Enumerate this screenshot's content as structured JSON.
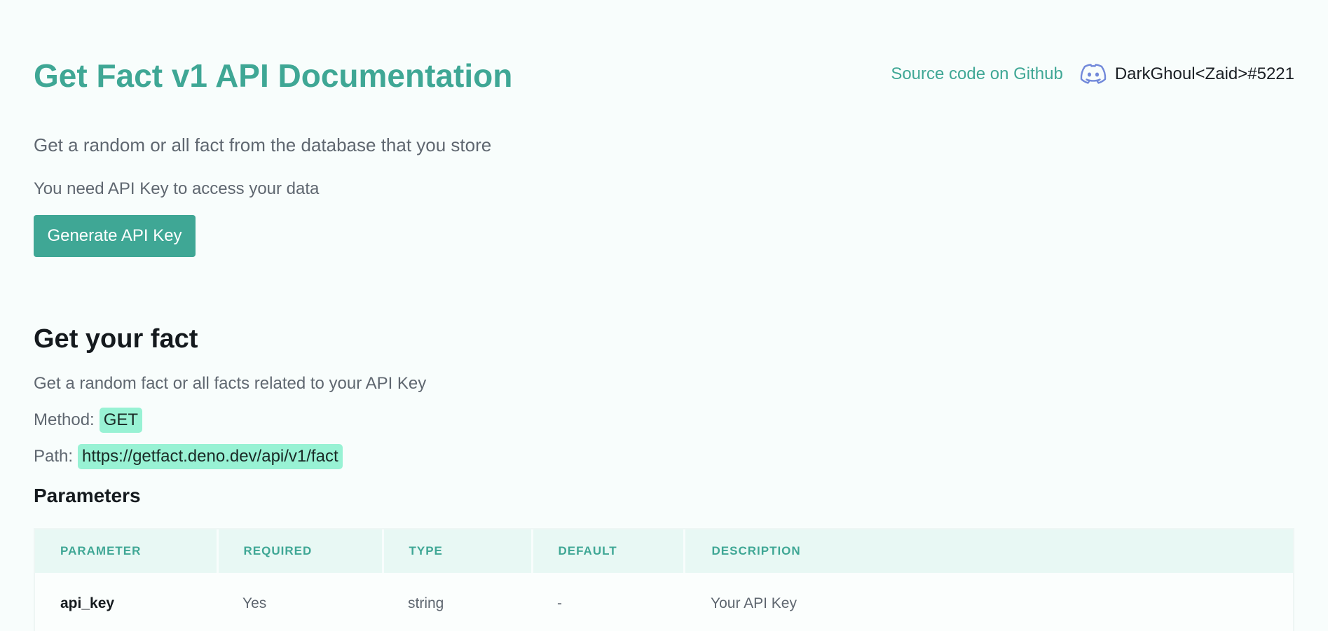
{
  "header": {
    "title": "Get Fact v1 API Documentation",
    "github_link": "Source code on Github",
    "discord_icon": "discord-icon",
    "discord_tag": "DarkGhoul<Zaid>#5221"
  },
  "intro": {
    "subtitle": "Get a random or all fact from the database that you store",
    "api_note": "You need API Key to access your data",
    "generate_button": "Generate API Key"
  },
  "section": {
    "heading": "Get your fact",
    "description": "Get a random fact or all facts related to your API Key",
    "method_label": "Method:",
    "method_value": "GET",
    "path_label": "Path:",
    "path_value": "https://getfact.deno.dev/api/v1/fact",
    "params_heading": "Parameters"
  },
  "table": {
    "headers": [
      "PARAMETER",
      "REQUIRED",
      "TYPE",
      "DEFAULT",
      "DESCRIPTION"
    ],
    "rows": [
      [
        "api_key",
        "Yes",
        "string",
        "-",
        "Your API Key"
      ]
    ]
  },
  "colors": {
    "accent": "#3fa795",
    "pill_bg": "#98f2d4",
    "discord": "#7289da",
    "background": "#f8fdfc"
  }
}
